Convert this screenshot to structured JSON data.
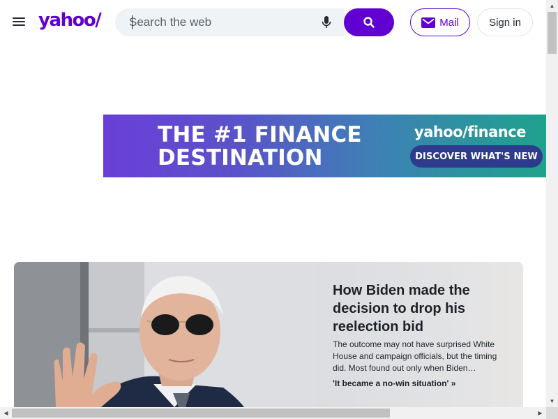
{
  "header": {
    "logo_text": "yahoo/",
    "search_placeholder": "Search the web",
    "mail_label": "Mail",
    "signin_label": "Sign in",
    "brand_color": "#6001d2",
    "icons": [
      "menu-icon",
      "mic-icon",
      "search-icon",
      "mail-icon"
    ]
  },
  "ad_banner": {
    "headline_line1": "THE #1 FINANCE",
    "headline_line2": "DESTINATION",
    "brand": "yahoo/finance",
    "cta": "DISCOVER WHAT'S NEW"
  },
  "hero_story": {
    "title": "How Biden made the decision to drop his reelection bid",
    "summary": "The outcome may not have surprised White House and campaign officials, but the timing did. Most found out only when Biden…",
    "related_link": "'It became a no-win situation' »"
  }
}
